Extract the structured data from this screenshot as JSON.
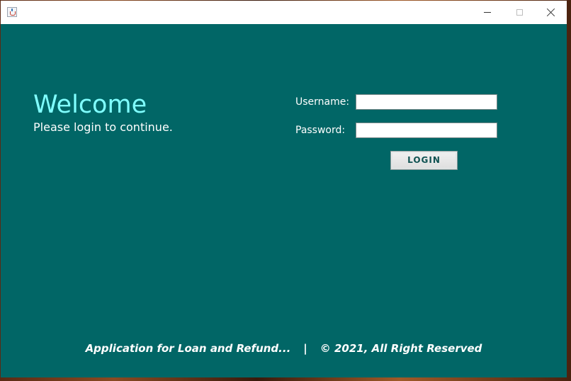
{
  "window": {
    "title": "",
    "icon": "java-coffee-icon"
  },
  "welcome": {
    "title": "Welcome",
    "subtitle": "Please login to continue."
  },
  "form": {
    "username_label": "Username:",
    "username_value": "",
    "password_label": "Password:",
    "password_value": "",
    "login_label": "LOGIN"
  },
  "footer": {
    "left": "Application for Loan and Refund...",
    "separator": "|",
    "right": "© 2021, All Right Reserved"
  },
  "colors": {
    "panel_background": "#016666",
    "welcome_accent": "#80ffff",
    "text": "#ffffff",
    "button_text": "#0f5252"
  }
}
